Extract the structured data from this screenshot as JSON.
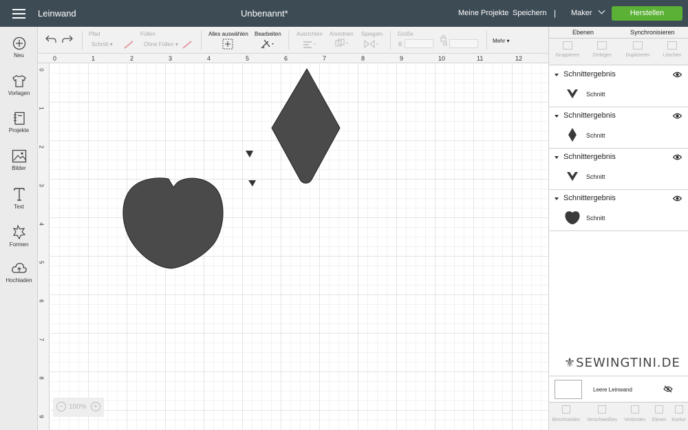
{
  "header": {
    "app_title": "Leinwand",
    "doc_title": "Unbenannt*",
    "my_projects": "Meine Projekte",
    "save": "Speichern",
    "separator": "|",
    "machine": "Maker",
    "make_button": "Herstellen",
    "make_color": "#5ab136",
    "bar_color": "#3d4b55"
  },
  "sidebar": {
    "items": [
      {
        "label": "Neu",
        "icon": "plus-circle-icon"
      },
      {
        "label": "Vorlagen",
        "icon": "shirt-icon"
      },
      {
        "label": "Projekte",
        "icon": "notebook-icon"
      },
      {
        "label": "Bilder",
        "icon": "image-icon"
      },
      {
        "label": "Text",
        "icon": "text-icon"
      },
      {
        "label": "Formen",
        "icon": "shapes-icon"
      },
      {
        "label": "Hochladen",
        "icon": "cloud-upload-icon"
      }
    ]
  },
  "toolbar": {
    "line_type_label": "Pfad",
    "line_type_value": "Schnitt",
    "fill_label": "Füllen",
    "fill_value": "Ohne Füllen",
    "select_all": "Alles auswählen",
    "edit": "Bearbeiten",
    "align": "Ausrichten",
    "arrange": "Anordnen",
    "flip": "Spiegeln",
    "size": "Größe",
    "width_label": "B",
    "height_label": "H",
    "more": "Mehr"
  },
  "canvas": {
    "ruler_top": [
      "0",
      "1",
      "2",
      "3",
      "4",
      "5",
      "6",
      "7",
      "8",
      "9",
      "10",
      "11",
      "12"
    ],
    "ruler_left": [
      "0",
      "1",
      "2",
      "3",
      "4",
      "5",
      "6",
      "7",
      "8",
      "9"
    ],
    "zoom": "100%",
    "shape_color": "#4a4a4a"
  },
  "layers_panel": {
    "tabs": [
      "Ebenen",
      "Synchronisieren"
    ],
    "tools": [
      "Gruppieren",
      "Zerlegen",
      "Duplizieren",
      "Löschen"
    ],
    "groups": [
      {
        "title": "Schnittergebnis",
        "item": "Schnitt",
        "thumb": "arrow-thumb"
      },
      {
        "title": "Schnittergebnis",
        "item": "Schnitt",
        "thumb": "diamond-thumb"
      },
      {
        "title": "Schnittergebnis",
        "item": "Schnitt",
        "thumb": "arrow-thumb"
      },
      {
        "title": "Schnittergebnis",
        "item": "Schnitt",
        "thumb": "heart-thumb"
      }
    ],
    "brand": "SEWINGTINI.DE",
    "blank_canvas": "Leere Leinwand",
    "bottom_tools": [
      "Beschneiden",
      "Verschweißen",
      "Verbinden",
      "Ebnen",
      "Kontur"
    ]
  }
}
